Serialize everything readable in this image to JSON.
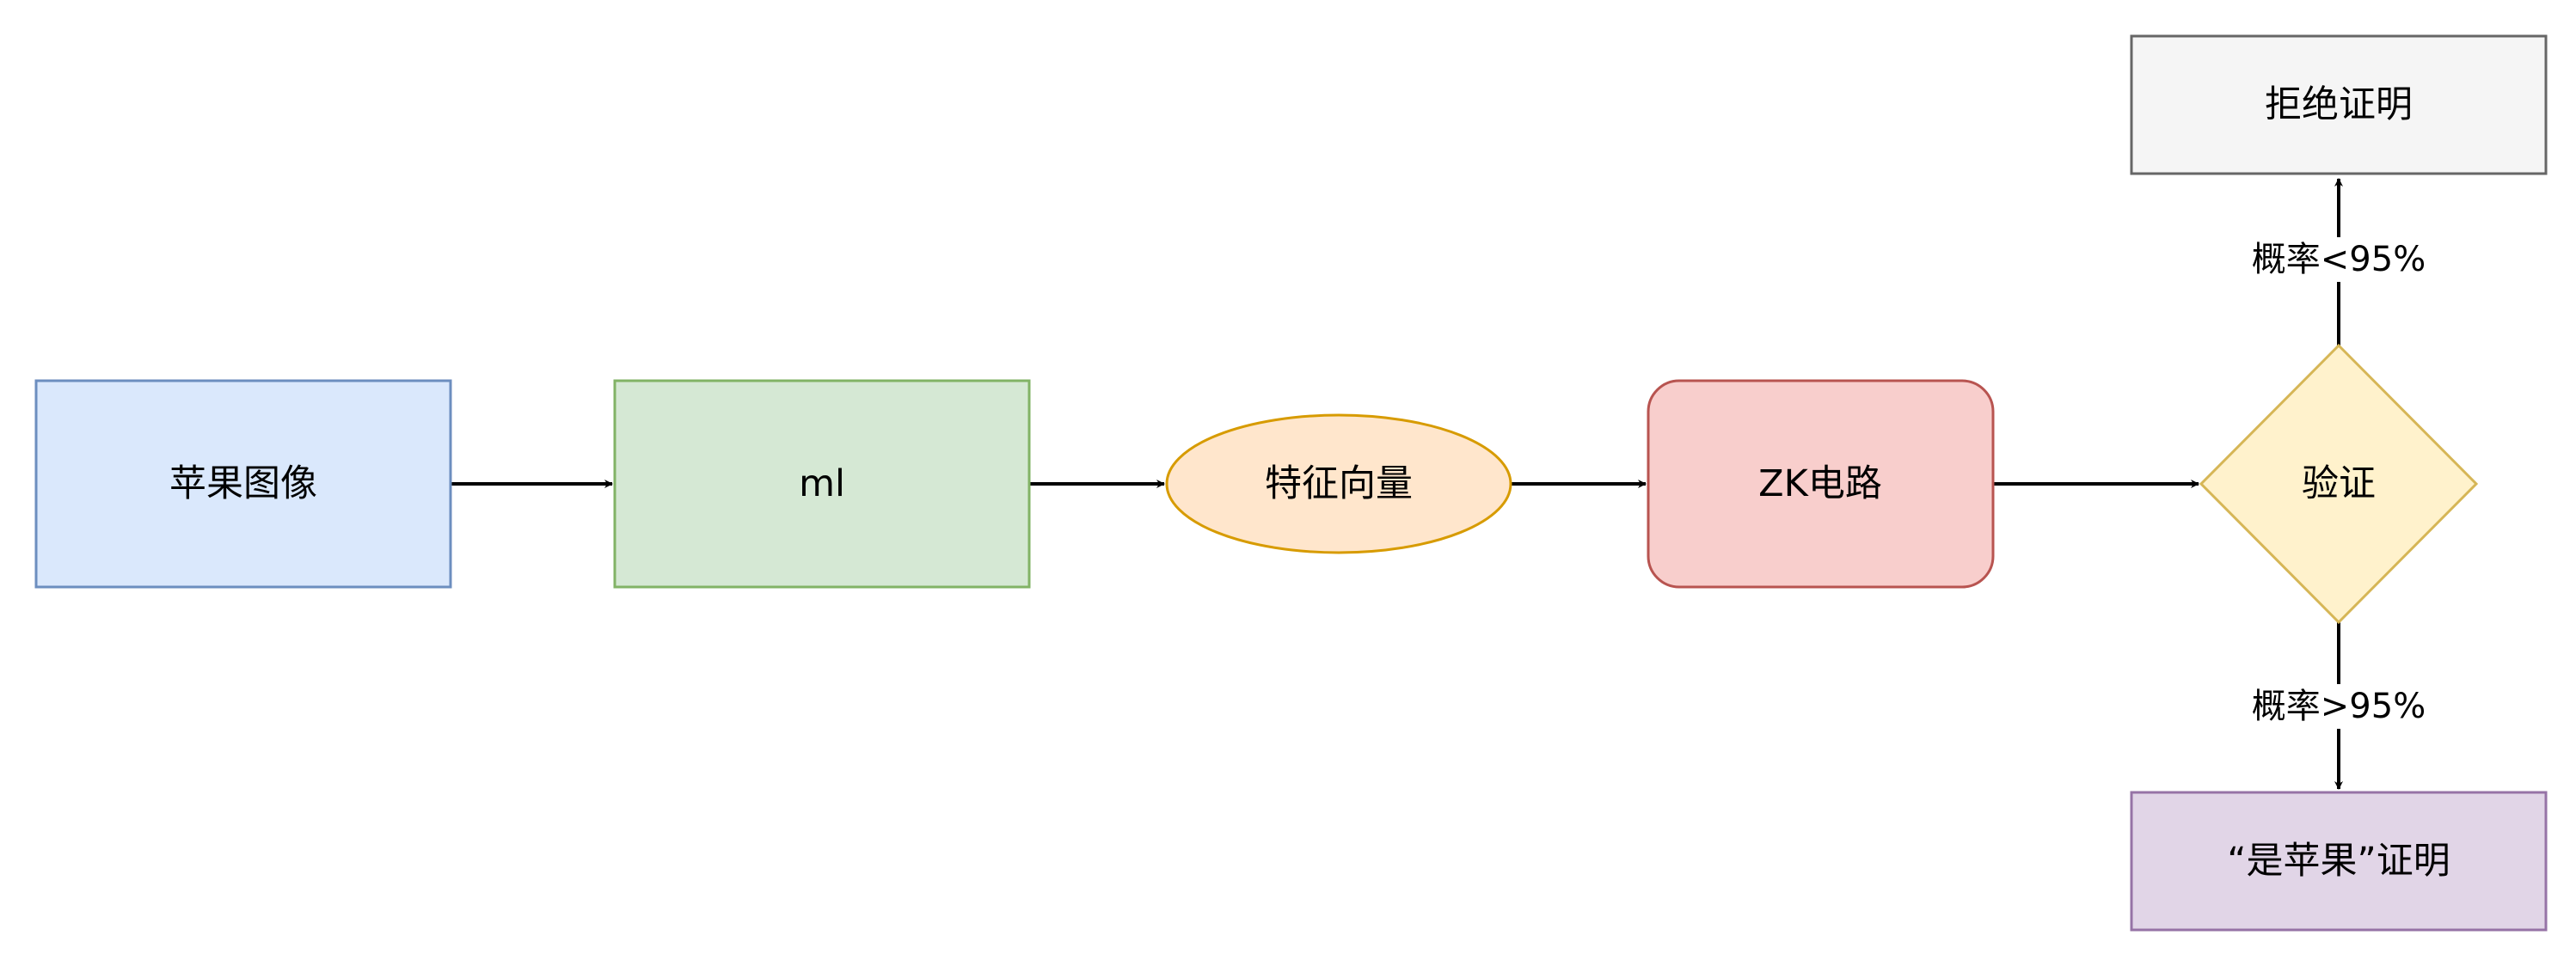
{
  "nodes": {
    "apple_image": {
      "label": "苹果图像",
      "fill": "#dae8fc",
      "stroke": "#6c8ebf"
    },
    "ml": {
      "label": "ml",
      "fill": "#d5e8d4",
      "stroke": "#82b366"
    },
    "feature_vector": {
      "label": "特征向量",
      "fill": "#ffe6cc",
      "stroke": "#d79b00"
    },
    "zk_circuit": {
      "label": "ZK电路",
      "fill": "#f8cecc",
      "stroke": "#b85450"
    },
    "verify": {
      "label": "验证",
      "fill": "#fff2cc",
      "stroke": "#d6b656"
    },
    "reject_proof": {
      "label": "拒绝证明",
      "fill": "#f5f5f5",
      "stroke": "#666666"
    },
    "is_apple_proof": {
      "label": "“是苹果”证明",
      "fill": "#e1d5e7",
      "stroke": "#9673a6"
    }
  },
  "edges": {
    "below_threshold": {
      "label": "概率<95%"
    },
    "above_threshold": {
      "label": "概率>95%"
    }
  }
}
